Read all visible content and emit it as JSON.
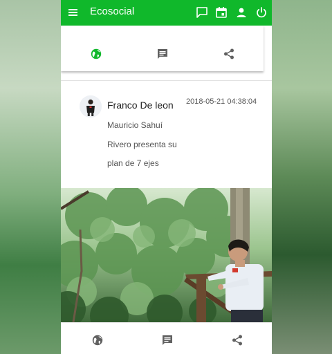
{
  "app": {
    "title": "Ecosocial",
    "brand_color": "#10b82b"
  },
  "toolbar": {
    "actions": [
      "chat-icon",
      "calendar-icon",
      "person-icon",
      "power-icon"
    ]
  },
  "top_card": {
    "icons": [
      "globe-icon",
      "comment-icon",
      "share-icon"
    ],
    "active_icon_color": "#10b82b"
  },
  "post": {
    "author": "Franco De leon",
    "timestamp": "2018-05-21 04:38:04",
    "lines": [
      "Mauricio Sahuí",
      "Rivero presenta su",
      "plan de 7 ejes"
    ]
  },
  "bottom_actions": {
    "icons": [
      "globe-icon",
      "comment-icon",
      "share-icon"
    ]
  }
}
